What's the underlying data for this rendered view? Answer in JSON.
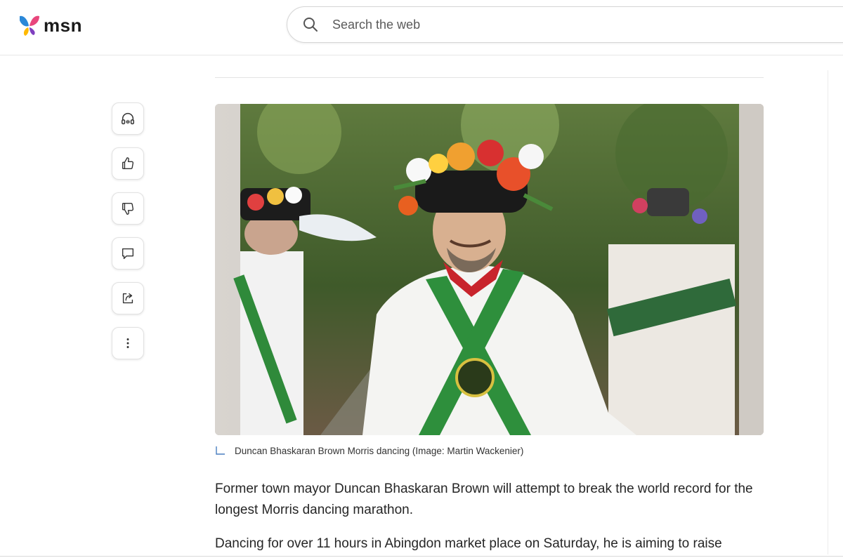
{
  "header": {
    "logo_text": "msn",
    "search_placeholder": "Search the web"
  },
  "actions": [
    {
      "name": "listen-button",
      "icon": "headphones-icon"
    },
    {
      "name": "like-button",
      "icon": "thumbs-up-icon"
    },
    {
      "name": "dislike-button",
      "icon": "thumbs-down-icon"
    },
    {
      "name": "comment-button",
      "icon": "comment-icon"
    },
    {
      "name": "share-button",
      "icon": "share-icon"
    },
    {
      "name": "more-button",
      "icon": "more-vertical-icon"
    }
  ],
  "article": {
    "image_caption": "Duncan Bhaskaran Brown Morris dancing (Image: Martin Wackenier)",
    "paragraphs": [
      "Former town mayor Duncan Bhaskaran Brown will attempt to break the world record for the longest Morris dancing marathon.",
      "Dancing for over 11 hours in Abingdon market place on Saturday, he is aiming to raise"
    ]
  },
  "colors": {
    "accent": "#0f6cbd",
    "text": "#262626",
    "logo_blue": "#2b88d8",
    "logo_pink": "#e8467c",
    "logo_yellow": "#ffb900"
  }
}
